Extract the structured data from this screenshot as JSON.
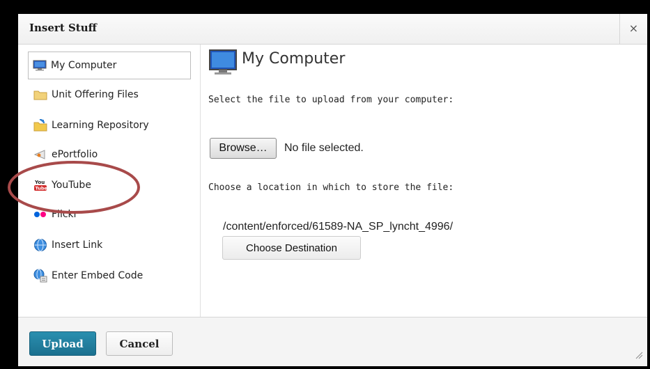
{
  "dialog": {
    "title": "Insert Stuff",
    "close_label": "×"
  },
  "sidebar": {
    "items": [
      {
        "label": "My Computer",
        "icon": "monitor-icon",
        "selected": true
      },
      {
        "label": "Unit Offering Files",
        "icon": "folder-icon"
      },
      {
        "label": "Learning Repository",
        "icon": "repository-folder-icon"
      },
      {
        "label": "ePortfolio",
        "icon": "eportfolio-icon"
      },
      {
        "label": "YouTube",
        "icon": "youtube-icon"
      },
      {
        "label": "Flickr",
        "icon": "flickr-icon"
      },
      {
        "label": "Insert Link",
        "icon": "globe-link-icon"
      },
      {
        "label": "Enter Embed Code",
        "icon": "embed-globe-icon"
      }
    ]
  },
  "main": {
    "heading": "My Computer",
    "select_prompt": "Select the file to upload from your computer:",
    "browse_label": "Browse…",
    "no_file_text": "No file selected.",
    "location_prompt": "Choose a location in which to store the file:",
    "destination_path": "/content/enforced/61589-NA_SP_lyncht_4996/",
    "choose_destination_label": "Choose Destination"
  },
  "footer": {
    "upload_label": "Upload",
    "cancel_label": "Cancel"
  },
  "colors": {
    "primary_button": "#1b708f",
    "annotation_circle": "#a84a4a",
    "frame": "#000000"
  }
}
